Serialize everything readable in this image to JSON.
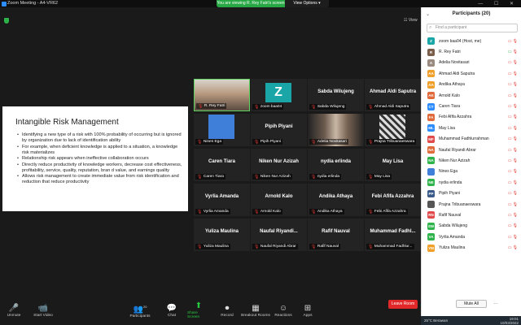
{
  "titlebar": {
    "title": "Zoom Meeting - A4-VR62",
    "viewing": "You are viewing R. Rey Fatri's screen",
    "view_options": "View Options ▾"
  },
  "main": {
    "view_label": "☷ View"
  },
  "slide": {
    "title": "Intangible Risk Management",
    "bullets": [
      "Identifying a new type of a risk with 100% probability of occurring but is ignored by organization due to lack of identification ability",
      "For example, when deficient knowledge is applied to a situation, a knowledge risk materializes",
      "Relationship risk appears when ineffective collaboration occurs",
      "Directly reduce productivity of knowledge workers, decrease cost effectiveness, profitability, service, quality, reputation, bran d value, and earnings quality",
      "Allows risk management to create immediate value from risk identification and reduction that reduce productivity"
    ]
  },
  "tiles": [
    {
      "big": "",
      "small": "R. Rey Fatri"
    },
    {
      "big": "",
      "small": "zoom baa04"
    },
    {
      "big": "Sabda Wilujeng",
      "small": "Sabda Wilujeng"
    },
    {
      "big": "Ahmad Aldi Saputra",
      "small": "Ahmad Aldi Saputra"
    },
    {
      "big": "",
      "small": "Nines Ega"
    },
    {
      "big": "Pipih Piyani",
      "small": "Pipih Piyani"
    },
    {
      "big": "",
      "small": "Adelia Novitasari"
    },
    {
      "big": "",
      "small": "Prajna Tribuanaeswara"
    },
    {
      "big": "Caren Tiara",
      "small": "Caren Tiara"
    },
    {
      "big": "Niken Nur Azizah",
      "small": "Niken Nur Azizah"
    },
    {
      "big": "nydia erlinda",
      "small": "nydia erlinda"
    },
    {
      "big": "May Lisa",
      "small": "May Lisa"
    },
    {
      "big": "Vyrlia Amanda",
      "small": "Vyrlia Amanda"
    },
    {
      "big": "Arnold Kalo",
      "small": "Arnold Kalo"
    },
    {
      "big": "Andika Athaya",
      "small": "Andika Athaya"
    },
    {
      "big": "Febi Afifa Azzahra",
      "small": "Febi Afifa Azzahra"
    },
    {
      "big": "Yuliza Maulina",
      "small": "Yuliza Maulina"
    },
    {
      "big": "Naufal Riyandi...",
      "small": "Naufal Riyandi Abrar"
    },
    {
      "big": "Rafif Nauval",
      "small": "Rafif Nauval"
    },
    {
      "big": "Muhammad Fadhl...",
      "small": "Muhammad Fadhlur..."
    }
  ],
  "zbox_letter": "Z",
  "toolbar": {
    "unmute": "Unmute",
    "start_video": "Start Video",
    "participants": "Participants",
    "participants_count": "20",
    "chat": "Chat",
    "share": "Share Screen",
    "record": "Record",
    "breakout": "Breakout Rooms",
    "reactions": "Reactions",
    "apps": "Apps",
    "leave": "Leave Room"
  },
  "panel": {
    "title": "Participants (20)",
    "search_placeholder": "Find a participant",
    "mute_all": "Mute All",
    "more": "…",
    "participants": [
      {
        "initials": "Z",
        "name": "zoom baa04 (Host, me)",
        "color": "#1aa6a6"
      },
      {
        "initials": "R",
        "name": "R. Rey Fatri",
        "color": "#7a5c4a"
      },
      {
        "initials": "A",
        "name": "Adelia Novitasari",
        "color": "#9a8a80"
      },
      {
        "initials": "AA",
        "name": "Ahmad Aldi Saputra",
        "color": "#f0a02a"
      },
      {
        "initials": "AA",
        "name": "Andika Athaya",
        "color": "#f0a02a"
      },
      {
        "initials": "AK",
        "name": "Arnold Kalo",
        "color": "#e06a3a"
      },
      {
        "initials": "CT",
        "name": "Caren Tiara",
        "color": "#2d8cff"
      },
      {
        "initials": "FA",
        "name": "Febi Afifa Azzahra",
        "color": "#e06a3a"
      },
      {
        "initials": "ML",
        "name": "May Lisa",
        "color": "#2d8cff"
      },
      {
        "initials": "MF",
        "name": "Muhammad Fadhlurrahman",
        "color": "#e04a4a"
      },
      {
        "initials": "NA",
        "name": "Naufal Riyandi Abrar",
        "color": "#e06a3a"
      },
      {
        "initials": "NA",
        "name": "Niken Nur Azizah",
        "color": "#2db34a"
      },
      {
        "initials": "",
        "name": "Nines Ega",
        "color": "#3f7fd9"
      },
      {
        "initials": "NE",
        "name": "nydia erlinda",
        "color": "#2db34a"
      },
      {
        "initials": "PP",
        "name": "Pipih Piyani",
        "color": "#3a5a8a"
      },
      {
        "initials": "",
        "name": "Prajna Tribuanaeswara",
        "color": "#555"
      },
      {
        "initials": "RN",
        "name": "Rafif Nauval",
        "color": "#e04a4a"
      },
      {
        "initials": "SW",
        "name": "Sabda Wilujeng",
        "color": "#2db34a"
      },
      {
        "initials": "VA",
        "name": "Vyrlia Amanda",
        "color": "#2db34a"
      },
      {
        "initials": "YM",
        "name": "Yuliza Maulina",
        "color": "#f0a02a"
      }
    ]
  },
  "taskbar": {
    "weather": "25°C Berawan",
    "time": "19:01",
    "date": "10/03/2022"
  }
}
